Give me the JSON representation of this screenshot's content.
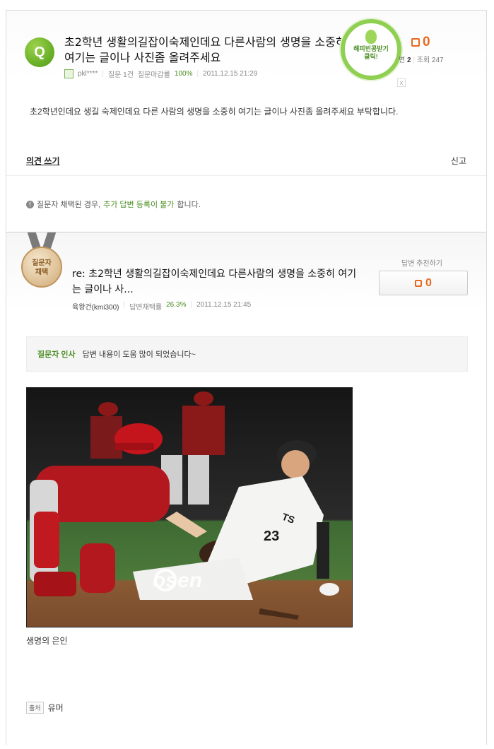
{
  "question": {
    "badge": "Q",
    "title": "초2학년 생활의길잡이숙제인데요 다른사람의 생명을 소중히 여기는 글이나 사진좀 올려주세요",
    "user": "pkl****",
    "question_count": "질문 1건",
    "closing_rate_label": "질문마감률",
    "closing_rate": "100%",
    "date": "2011.12.15 21:29",
    "likes": "0",
    "answers_label": "변",
    "answers": "2",
    "views_label": "조회",
    "views": "247",
    "body": "초2학년인데요 생길 숙제인데요 다른 사람의 생명을 소중히 여기는 글이나 사진좀 올려주세요 부탁합니다."
  },
  "happy_bean": {
    "line1": "해피빈콩받기",
    "line2": "클릭!",
    "close": "x"
  },
  "actions": {
    "write_opinion": "의견 쓰기",
    "report": "신고"
  },
  "notice": {
    "icon": "!",
    "prefix": "질문자 채택된 경우,",
    "highlight": "추가 답변 등록이 불가",
    "suffix": "합니다."
  },
  "answer": {
    "medal_line1": "질문자",
    "medal_line2": "채택",
    "title": "re: 초2학년 생활의길잡이숙제인데요 다른사람의 생명을 소중히 여기는 글이나 사...",
    "author": "육왕건(kmi300)",
    "adoption_rate_label": "답변채택률",
    "adoption_rate": "26.3%",
    "date": "2011.12.15 21:45",
    "recommend_label": "답변 추천하기",
    "recommend_count": "0",
    "greeting_label": "질문자 인사",
    "greeting_text": "답변 내용이 도움 많이 되었습니다~",
    "photo_watermark": "osen",
    "photo_jersey_number": "23",
    "photo_jersey_text": "TS",
    "caption": "생명의 은인",
    "source_tag": "출처",
    "source": "유머"
  }
}
